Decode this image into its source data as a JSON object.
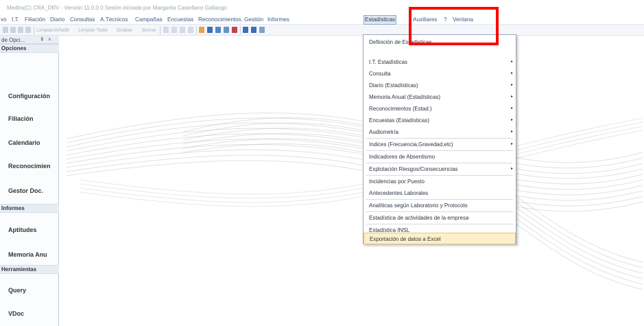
{
  "window": {
    "title": "Medtra(C) CRA_DRV - Versión 11.0.0.0 Sesión iniciada por Margarita Castellano Gallango"
  },
  "menubar": {
    "items": [
      {
        "id": "archivo",
        "label": "vo"
      },
      {
        "id": "it",
        "label": "I.T."
      },
      {
        "id": "filiacion",
        "label": "Filiación"
      },
      {
        "id": "diario",
        "label": "Diario"
      },
      {
        "id": "consultas",
        "label": "Consultas"
      },
      {
        "id": "atecnicos",
        "label": "A.Técnicos"
      },
      {
        "id": "campanas",
        "label": "Campañas"
      },
      {
        "id": "encuestas",
        "label": "Encuestas"
      },
      {
        "id": "reconocimientos",
        "label": "Reconocimientos"
      },
      {
        "id": "gestion",
        "label": "Gestión"
      },
      {
        "id": "informes",
        "label": "Informes"
      },
      {
        "id": "estadisticas",
        "label": "Estadísticas"
      },
      {
        "id": "auxiliares",
        "label": "Auxiliares"
      },
      {
        "id": "ayuda",
        "label": "?"
      },
      {
        "id": "ventana",
        "label": "Ventana"
      }
    ]
  },
  "toolbar": {
    "limpiar_anadir": "Limpiar/Añadir",
    "limpiar_todo": "Limpiar Todo",
    "grabar": "Grabar",
    "borrar": "Borrar"
  },
  "sidebar": {
    "panel_title": "de Opci...",
    "pin": "⇞",
    "close": "×",
    "sections": {
      "opciones": "Opciones",
      "informes": "Informes",
      "herramientas": "Herramientas"
    },
    "items": {
      "configuracion": "Configuración",
      "filiacion": "Filiación",
      "calendario": "Calendario",
      "reconocimientos": "Reconocimien",
      "gestor_doc": "Gestor Doc.",
      "aptitudes": "Aptitudes",
      "memoria_anual": "Memoria Anu",
      "query": "Query",
      "vdoc": "VDoc"
    }
  },
  "dropdown": {
    "items": [
      {
        "label": "Definición de Estadísticas",
        "submenu": false
      },
      {
        "label": "I.T. Estadísticas",
        "submenu": true
      },
      {
        "label": "Consulta",
        "submenu": true
      },
      {
        "label": "Diario (Estadísticas)",
        "submenu": true
      },
      {
        "label": "Memoria Anual (Estadísticas)",
        "submenu": true
      },
      {
        "label": "Reconocimientos (Estad.)",
        "submenu": true
      },
      {
        "label": "Encuestas (Estadísticas)",
        "submenu": true
      },
      {
        "label": "Audiometría",
        "submenu": true
      },
      {
        "label": "Indices (Frecuencia,Gravedad,etc)",
        "submenu": true
      },
      {
        "label": "Indicadores de Absentismo",
        "submenu": false
      },
      {
        "label": "Explotación Riesgos/Consecuencias",
        "submenu": true
      },
      {
        "label": "Incidencias por Puesto",
        "submenu": false
      },
      {
        "label": "Antecedentes Laborales",
        "submenu": false
      },
      {
        "label": "Analíticas según Laboratorio y Protocolo",
        "submenu": false
      },
      {
        "label": "Estadística de actividades de la empresa",
        "submenu": false
      },
      {
        "label": "Estadística INSL",
        "submenu": false
      },
      {
        "label": "Exportación de datos a Excel",
        "submenu": false,
        "highlighted": true
      }
    ],
    "submenu_glyph": "▸"
  },
  "colors": {
    "menu_text": "#3c5a84",
    "highlight_bg": "#fdf0c8",
    "annotation": "#ff0000"
  }
}
